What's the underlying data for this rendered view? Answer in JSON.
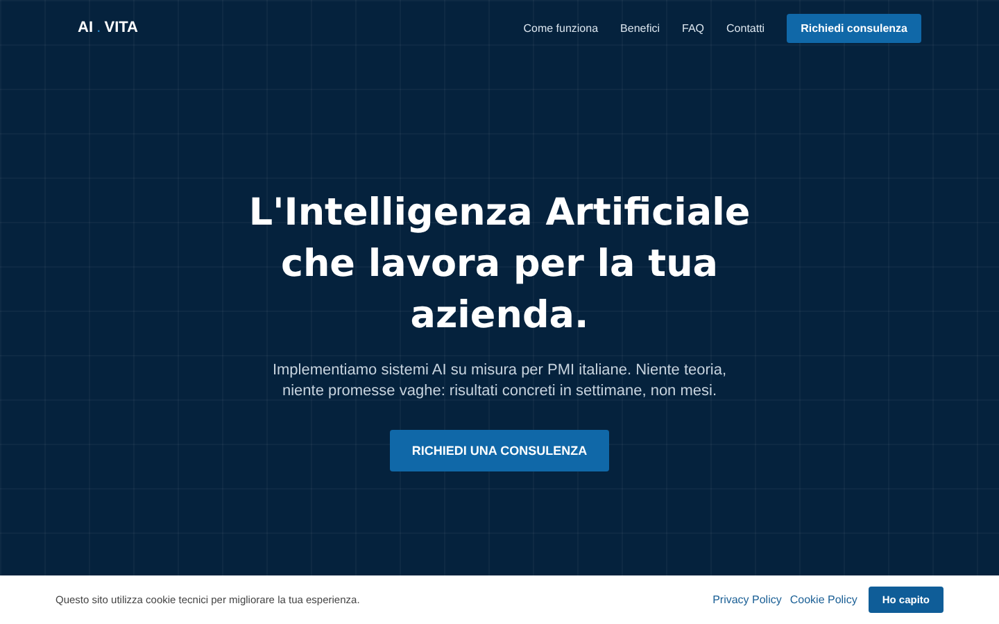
{
  "header": {
    "logo": {
      "first": "AI",
      "separator": ".",
      "second": "VITA"
    },
    "nav": [
      {
        "label": "Come funziona"
      },
      {
        "label": "Benefici"
      },
      {
        "label": "FAQ"
      },
      {
        "label": "Contatti"
      }
    ],
    "cta": "Richiedi consulenza"
  },
  "hero": {
    "title": "L'Intelligenza Artificiale che lavora per la tua azienda.",
    "subtitle": "Implementiamo sistemi AI su misura per PMI italiane. Niente teoria, niente promesse vaghe: risultati concreti in settimane, non mesi.",
    "button": "RICHIEDI UNA CONSULENZA"
  },
  "cookie_bar": {
    "message": "Questo sito utilizza cookie tecnici per migliorare la tua esperienza.",
    "links": [
      "Privacy Policy",
      "Cookie Policy"
    ],
    "button": "Ho capito"
  }
}
